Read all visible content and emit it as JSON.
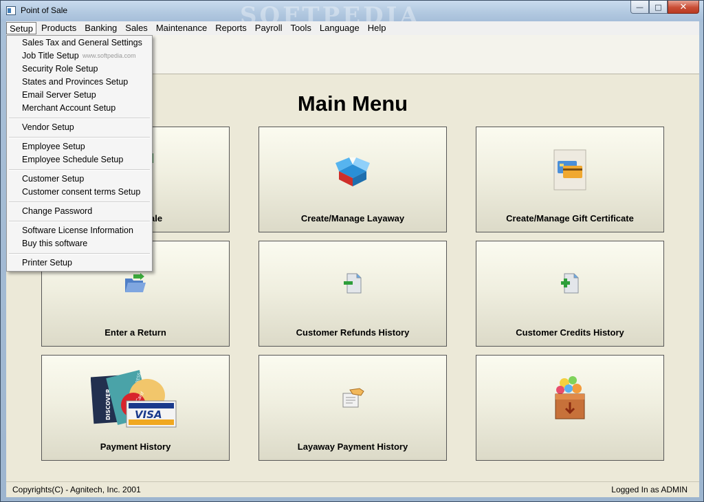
{
  "window": {
    "title": "Point of Sale",
    "watermark": "SOFTPEDIA",
    "controls": {
      "minimize": "—",
      "maximize": "□",
      "close": "✕"
    }
  },
  "menubar": {
    "items": [
      "Setup",
      "Products",
      "Banking",
      "Sales",
      "Maintenance",
      "Reports",
      "Payroll",
      "Tools",
      "Language",
      "Help"
    ],
    "active": "Setup"
  },
  "setup_menu": {
    "groups": [
      [
        "Sales Tax and General Settings",
        "Job Title Setup",
        "Security Role Setup",
        "States and Provinces Setup",
        "Email Server Setup",
        "Merchant Account Setup"
      ],
      [
        "Vendor Setup"
      ],
      [
        "Employee Setup",
        "Employee Schedule Setup"
      ],
      [
        "Customer Setup",
        "Customer consent terms Setup"
      ],
      [
        "Change Password"
      ],
      [
        "Software License Information",
        "Buy this software"
      ],
      [
        "Printer Setup"
      ]
    ],
    "watermark_text": "www.softpedia.com"
  },
  "main": {
    "title": "Main Menu",
    "tiles": [
      {
        "label": "ale",
        "icon": "register-icon"
      },
      {
        "label": "Create/Manage Layaway",
        "icon": "open-box-icon"
      },
      {
        "label": "Create/Manage Gift Certificate",
        "icon": "gift-card-icon"
      },
      {
        "label": "Enter a Return",
        "icon": "folder-return-icon"
      },
      {
        "label": "Customer Refunds History",
        "icon": "document-minus-icon"
      },
      {
        "label": "Customer Credits History",
        "icon": "document-plus-icon"
      },
      {
        "label": "Payment History",
        "icon": "credit-cards-icon"
      },
      {
        "label": "Layaway Payment History",
        "icon": "hand-document-icon"
      },
      {
        "label": "",
        "icon": "treasure-chest-icon"
      }
    ],
    "card_texts": {
      "visa": "VISA",
      "discover": "DISCOVER",
      "mastercard": "MasterCard",
      "amex": "AMERICAN EXPRESS"
    }
  },
  "status": {
    "copyright": "Copyrights(C) - Agnitech, Inc. 2001",
    "user": "Logged In as ADMIN"
  },
  "colors": {
    "titlebar": "#b5cbe2",
    "client_bg": "#ece9d8",
    "close_button": "#c94d35"
  }
}
